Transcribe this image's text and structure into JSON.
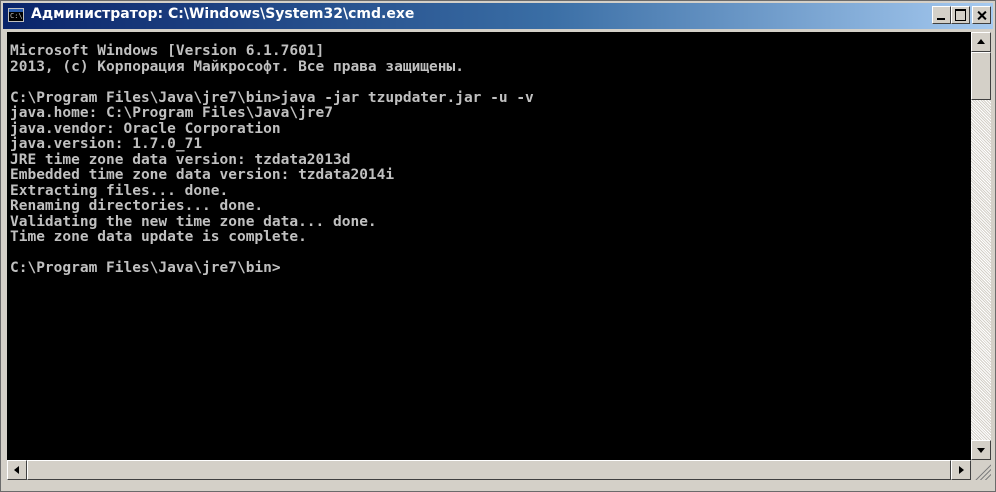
{
  "window": {
    "title": "Администратор: C:\\Windows\\System32\\cmd.exe",
    "icon_label": "C:\\",
    "title_gradient": [
      "#0a246a",
      "#a6caf0"
    ]
  },
  "console": {
    "background": "#000000",
    "foreground": "#c0c0c0",
    "lines": [
      "Microsoft Windows [Version 6.1.7601]",
      "2013, (c) Корпорация Майкрософт. Все права защищены.",
      "",
      "C:\\Program Files\\Java\\jre7\\bin>java -jar tzupdater.jar -u -v",
      "java.home: C:\\Program Files\\Java\\jre7",
      "java.vendor: Oracle Corporation",
      "java.version: 1.7.0_71",
      "JRE time zone data version: tzdata2013d",
      "Embedded time zone data version: tzdata2014i",
      "Extracting files... done.",
      "Renaming directories... done.",
      "Validating the new time zone data... done.",
      "Time zone data update is complete.",
      "",
      "C:\\Program Files\\Java\\jre7\\bin>"
    ]
  },
  "icons": {
    "app": "cmd-app-icon",
    "minimize": "minimize-icon",
    "maximize": "maximize-icon",
    "close": "close-icon",
    "scroll_up": "arrow-up-icon",
    "scroll_down": "arrow-down-icon",
    "scroll_left": "arrow-left-icon",
    "scroll_right": "arrow-right-icon",
    "resize_grip": "resize-grip-icon"
  }
}
